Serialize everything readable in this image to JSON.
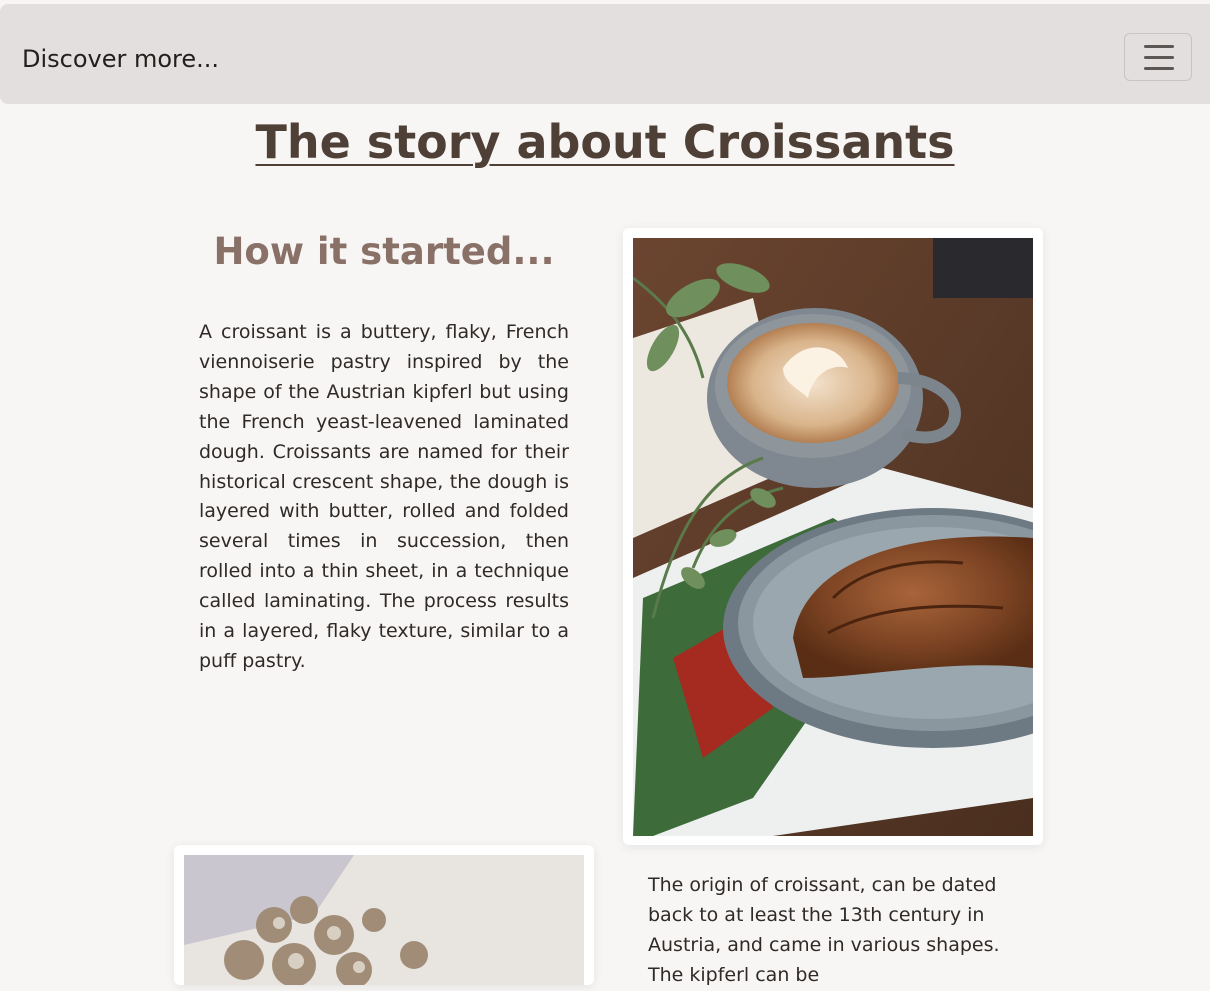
{
  "navbar": {
    "brand": "Discover more...",
    "toggle_icon": "hamburger-menu-icon"
  },
  "page": {
    "title": "The story about Croissants"
  },
  "section": {
    "heading": "How it started...",
    "paragraph_1": "A croissant is a buttery, flaky, French viennoiserie pastry inspired by the shape of the Austrian kipferl but using the French yeast-leavened laminated dough. Croissants are named for their historical crescent shape, the dough is layered with butter, rolled and folded several times in succession, then rolled into a thin sheet, in a technique called laminating. The process results in a layered, flaky texture, similar to a puff pastry.",
    "paragraph_2": "The origin of croissant, can be dated back to at least the 13th century in Austria, and came in various shapes. The kipferl can be"
  },
  "images": {
    "photo_1_subject": "coffee-and-croissant-photo",
    "photo_2_subject": "dried-flowers-photo"
  },
  "colors": {
    "navbar_bg": "#e2dfde",
    "page_bg": "#f8f6f4",
    "title": "#4e3f37",
    "heading": "#8a7168"
  }
}
